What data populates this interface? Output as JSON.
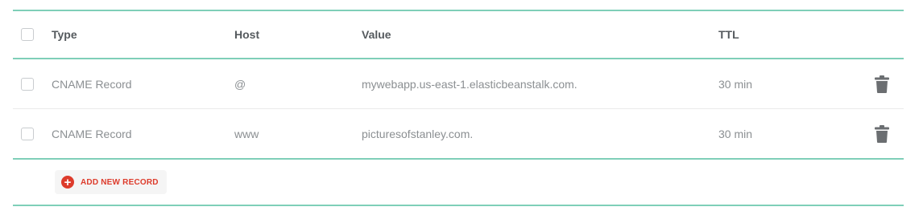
{
  "table": {
    "columns": {
      "type": "Type",
      "host": "Host",
      "value": "Value",
      "ttl": "TTL"
    },
    "rows": [
      {
        "type": "CNAME Record",
        "host": "@",
        "value": "mywebapp.us-east-1.elasticbeanstalk.com.",
        "ttl": "30 min"
      },
      {
        "type": "CNAME Record",
        "host": "www",
        "value": "picturesofstanley.com.",
        "ttl": "30 min"
      }
    ]
  },
  "actions": {
    "add_record_label": "ADD NEW RECORD",
    "add_icon": "plus-circle-icon",
    "delete_icon": "trash-icon"
  },
  "colors": {
    "accent_rule": "#7fcfb8",
    "add_red": "#dd3b2b"
  }
}
